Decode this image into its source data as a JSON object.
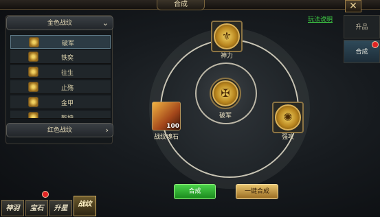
{
  "window": {
    "title": "合成",
    "close_label": "✕",
    "help_link": "玩法说明"
  },
  "left_panel": {
    "top_category": {
      "label": "金色战纹",
      "arrow": "⌄"
    },
    "items": [
      {
        "label": "破军",
        "icon": "gold-rune-icon",
        "selected": true
      },
      {
        "label": "铁奕",
        "icon": "gold-rune-icon"
      },
      {
        "label": "往生",
        "icon": "gold-rune-icon"
      },
      {
        "label": "止殇",
        "icon": "gold-rune-icon"
      },
      {
        "label": "金甲",
        "icon": "gold-rune-icon"
      },
      {
        "label": "乾坤",
        "icon": "gold-rune-icon"
      }
    ],
    "bottom_category": {
      "label": "红色战纹",
      "arrow": "›"
    }
  },
  "right_tabs": [
    {
      "label": "升品",
      "active": false
    },
    {
      "label": "合成",
      "active": true
    }
  ],
  "synthesis": {
    "top_slot": {
      "label": "神力",
      "icon": "shenli-rune-icon"
    },
    "center_slot": {
      "label": "破军",
      "icon": "pojun-rune-icon"
    },
    "right_slot": {
      "label": "强攻",
      "icon": "qianggong-rune-icon"
    },
    "material": {
      "label": "战纹魂石",
      "count": "100",
      "icon": "rune-soulstone-icon"
    }
  },
  "buttons": {
    "synthesize": "合成",
    "one_click": "一键合成"
  },
  "bottom_tabs": [
    {
      "label": "神羽",
      "active": false
    },
    {
      "label": "宝石",
      "active": false
    },
    {
      "label": "升星",
      "active": false
    },
    {
      "label": "战纹",
      "active": true
    }
  ],
  "colors": {
    "accent_gold": "#d9b15a",
    "help_green": "#3fcf45",
    "notify_red": "#e02424"
  }
}
